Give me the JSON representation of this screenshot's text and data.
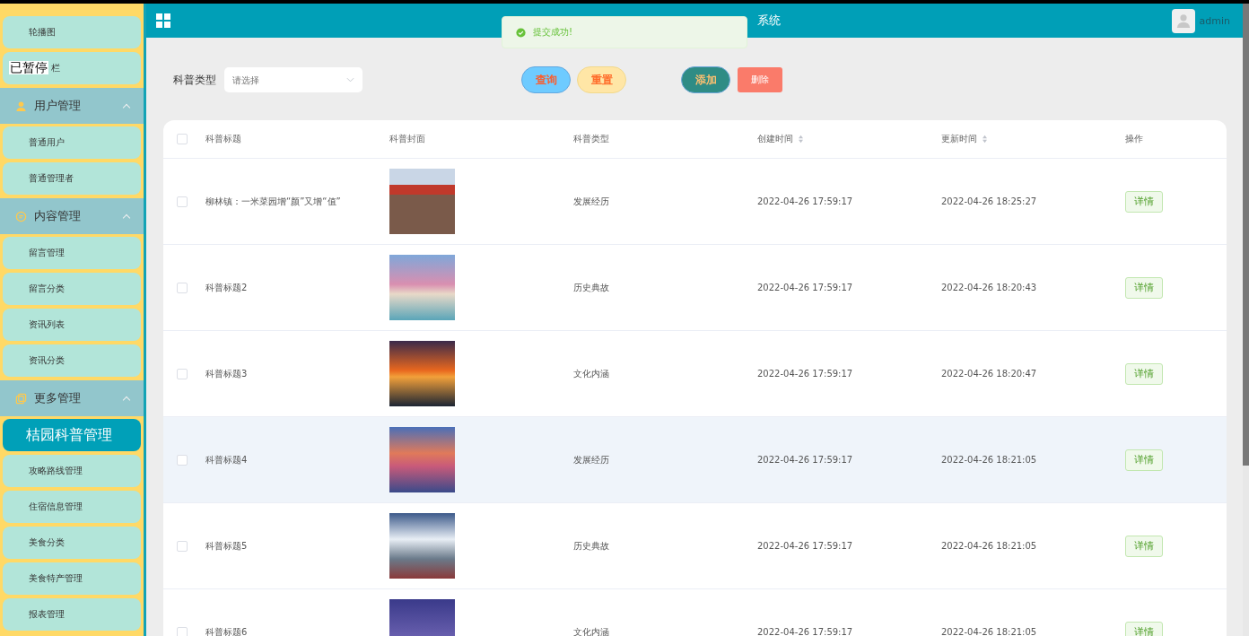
{
  "header": {
    "title": "系统",
    "user": "admin"
  },
  "toast": {
    "message": "提交成功!"
  },
  "overlay": {
    "text": "已暂停"
  },
  "sidebar": [
    {
      "kind": "item",
      "label": "轮播图",
      "selected": false
    },
    {
      "kind": "item",
      "label": "栏",
      "selected": false
    },
    {
      "kind": "group",
      "label": "用户管理",
      "expanded": true
    },
    {
      "kind": "item",
      "label": "普通用户",
      "selected": false
    },
    {
      "kind": "item",
      "label": "普通管理者",
      "selected": false
    },
    {
      "kind": "group",
      "label": "内容管理",
      "expanded": true
    },
    {
      "kind": "item",
      "label": "留言管理",
      "selected": false
    },
    {
      "kind": "item",
      "label": "留言分类",
      "selected": false
    },
    {
      "kind": "item",
      "label": "资讯列表",
      "selected": false
    },
    {
      "kind": "item",
      "label": "资讯分类",
      "selected": false
    },
    {
      "kind": "group",
      "label": "更多管理",
      "expanded": true
    },
    {
      "kind": "item",
      "label": "桔园科普管理",
      "selected": true
    },
    {
      "kind": "item",
      "label": "攻略路线管理",
      "selected": false
    },
    {
      "kind": "item",
      "label": "住宿信息管理",
      "selected": false
    },
    {
      "kind": "item",
      "label": "美食分类",
      "selected": false
    },
    {
      "kind": "item",
      "label": "美食特产管理",
      "selected": false
    },
    {
      "kind": "item",
      "label": "报表管理",
      "selected": false
    }
  ],
  "filter": {
    "label": "科普类型",
    "placeholder": "请选择"
  },
  "buttons": [
    {
      "kind": "query",
      "label": "查询"
    },
    {
      "kind": "reset",
      "label": "重置"
    },
    {
      "kind": "add",
      "label": "添加"
    },
    {
      "kind": "delete",
      "label": "删除"
    }
  ],
  "table": {
    "all_checked": false,
    "columns": [
      {
        "label": "科普标题",
        "sortable": false
      },
      {
        "label": "科普封面",
        "sortable": false
      },
      {
        "label": "科普类型",
        "sortable": false
      },
      {
        "label": "创建时间",
        "sortable": true
      },
      {
        "label": "更新时间",
        "sortable": true
      },
      {
        "label": "操作",
        "sortable": false
      }
    ],
    "rows": [
      {
        "checked": false,
        "hovered": false,
        "title": "柳林镇：一米菜园增“颜”又增“值”",
        "type": "发展经历",
        "created": "2022-04-26 17:59:17",
        "updated": "2022-04-26 18:25:27",
        "action": "详情"
      },
      {
        "checked": false,
        "hovered": false,
        "title": "科普标题2",
        "type": "历史典故",
        "created": "2022-04-26 17:59:17",
        "updated": "2022-04-26 18:20:43",
        "action": "详情"
      },
      {
        "checked": false,
        "hovered": false,
        "title": "科普标题3",
        "type": "文化内涵",
        "created": "2022-04-26 17:59:17",
        "updated": "2022-04-26 18:20:47",
        "action": "详情"
      },
      {
        "checked": false,
        "hovered": true,
        "title": "科普标题4",
        "type": "发展经历",
        "created": "2022-04-26 17:59:17",
        "updated": "2022-04-26 18:21:05",
        "action": "详情"
      },
      {
        "checked": false,
        "hovered": false,
        "title": "科普标题5",
        "type": "历史典故",
        "created": "2022-04-26 17:59:17",
        "updated": "2022-04-26 18:21:05",
        "action": "详情"
      },
      {
        "checked": false,
        "hovered": false,
        "title": "科普标题6",
        "type": "文化内涵",
        "created": "2022-04-26 17:59:17",
        "updated": "2022-04-26 18:21:05",
        "action": "详情"
      }
    ]
  }
}
